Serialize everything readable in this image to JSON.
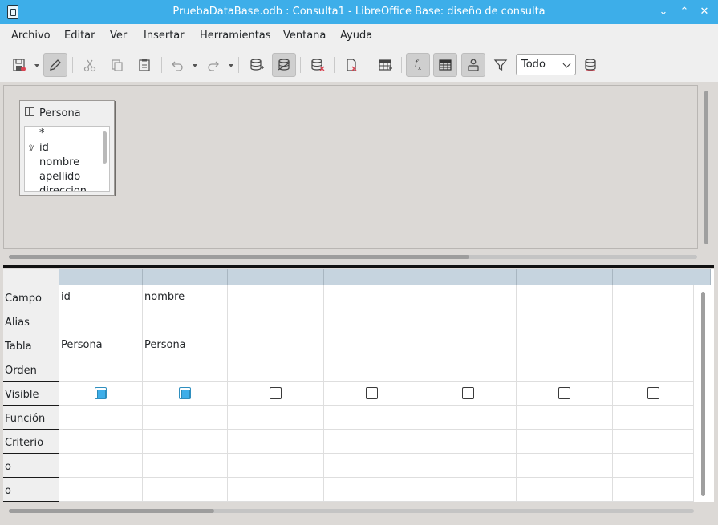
{
  "window": {
    "title": "PruebaDataBase.odb : Consulta1 - LibreOffice Base: diseño de consulta"
  },
  "menu": [
    "Archivo",
    "Editar",
    "Ver",
    "Insertar",
    "Herramientas",
    "Ventana",
    "Ayuda"
  ],
  "toolbar": {
    "limit_select_value": "Todo",
    "icons": [
      "save-icon",
      "edit-mode-icon",
      "cut-icon",
      "copy-icon",
      "paste-icon",
      "undo-icon",
      "redo-icon",
      "add-table-icon",
      "design-view-icon",
      "clear-query-icon",
      "delete-icon",
      "run-query-icon",
      "functions-icon",
      "table-name-icon",
      "alias-icon",
      "distinct-values-icon",
      "sql-run-icon"
    ]
  },
  "design": {
    "table": {
      "name": "Persona",
      "fields": [
        "*",
        "id",
        "nombre",
        "apellido",
        "direccion"
      ]
    }
  },
  "grid": {
    "row_labels": [
      "Campo",
      "Alias",
      "Tabla",
      "Orden",
      "Visible",
      "Función",
      "Criterio",
      "o",
      "o"
    ],
    "columns": [
      {
        "campo": "id",
        "tabla": "Persona",
        "visible": true
      },
      {
        "campo": "nombre",
        "tabla": "Persona",
        "visible": true
      },
      {
        "campo": "",
        "tabla": "",
        "visible": false
      },
      {
        "campo": "",
        "tabla": "",
        "visible": false
      },
      {
        "campo": "",
        "tabla": "",
        "visible": false
      },
      {
        "campo": "",
        "tabla": "",
        "visible": false
      },
      {
        "campo": "",
        "tabla": "",
        "visible": false
      }
    ]
  },
  "colors": {
    "titlebar": "#3daee9",
    "grid_header": "#c6d4df",
    "checkbox_checked": "#3daee9"
  }
}
